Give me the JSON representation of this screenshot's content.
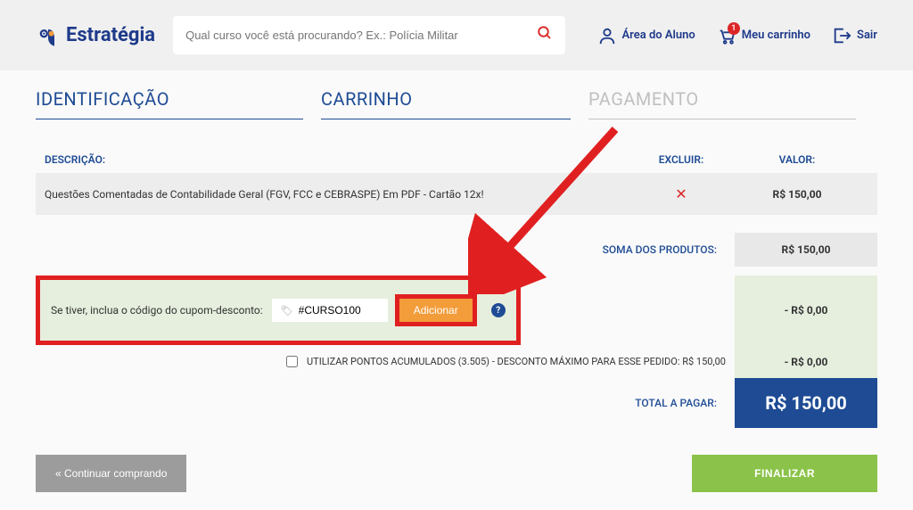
{
  "header": {
    "brand": "Estratégia",
    "search_placeholder": "Qual curso você está procurando? Ex.: Polícia Militar",
    "student_area": "Área do Aluno",
    "cart_label": "Meu carrinho",
    "cart_count": "1",
    "logout": "Sair"
  },
  "steps": {
    "identification": "IDENTIFICAÇÃO",
    "cart": "CARRINHO",
    "payment": "PAGAMENTO"
  },
  "table": {
    "header_description": "DESCRIÇÃO:",
    "header_delete": "EXCLUIR:",
    "header_value": "VALOR:",
    "item_description": "Questões Comentadas de Contabilidade Geral (FGV, FCC e CEBRASPE) Em PDF - Cartão 12x!",
    "item_value": "R$ 150,00"
  },
  "summary": {
    "products_sum_label": "SOMA DOS PRODUTOS:",
    "products_sum_value": "R$ 150,00",
    "coupon_label": "Se tiver, inclua o código do cupom-desconto:",
    "coupon_value": "#CURSO100",
    "add_button": "Adicionar",
    "coupon_discount": "- R$ 0,00",
    "points_label": "UTILIZAR PONTOS ACUMULADOS (3.505) - DESCONTO MÁXIMO PARA ESSE PEDIDO: R$ 150,00",
    "points_discount": "- R$ 0,00",
    "total_label": "TOTAL A PAGAR:",
    "total_value": "R$ 150,00"
  },
  "footer": {
    "continue": "« Continuar comprando",
    "finalize": "FINALIZAR"
  }
}
